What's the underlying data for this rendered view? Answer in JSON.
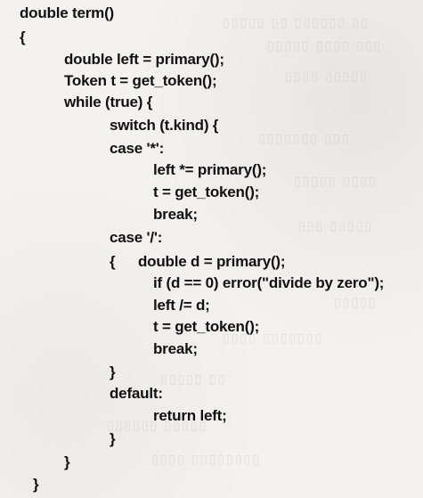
{
  "code_lines": [
    "double term()",
    "{",
    "double left = primary();",
    "Token t = get_token();",
    "while (true) {",
    "switch (t.kind) {",
    "case '*':",
    "left *= primary();",
    "t = get_token();",
    "break;",
    "case '/':",
    "{",
    "double d = primary();",
    "if (d == 0) error(\"divide by zero\");",
    "left /= d;",
    "t = get_token();",
    "break;",
    "}",
    "default:",
    "return left;",
    "}",
    "}",
    "}"
  ]
}
